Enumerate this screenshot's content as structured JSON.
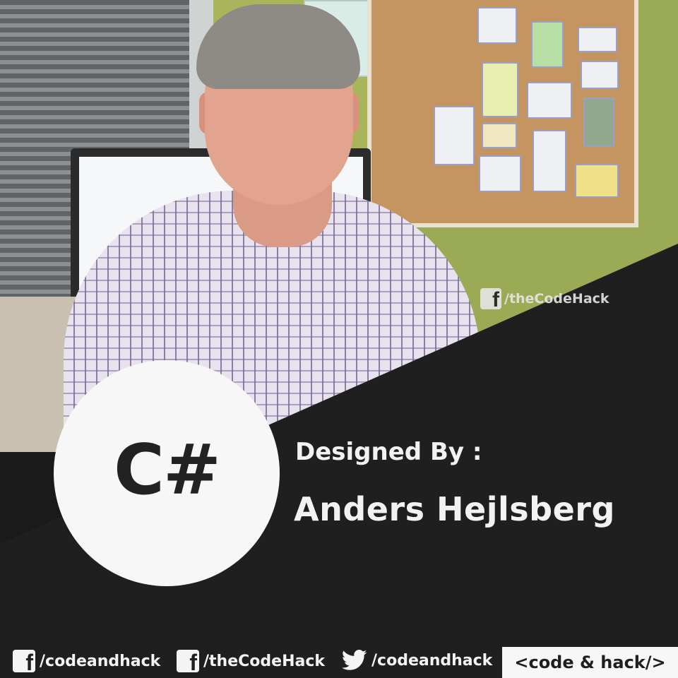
{
  "watermark": {
    "icon": "facebook-icon",
    "handle": "/theCodeHack"
  },
  "logo": {
    "text": "C#"
  },
  "caption": {
    "designed_by": "Designed By :",
    "name": "Anders Hejlsberg"
  },
  "footer": {
    "links": [
      {
        "icon": "facebook-icon",
        "handle": "/codeandhack"
      },
      {
        "icon": "facebook-icon",
        "handle": "/theCodeHack"
      },
      {
        "icon": "twitter-icon",
        "handle": "/codeandhack"
      }
    ],
    "brand": "<code & hack/>"
  },
  "colors": {
    "panel": "#1f1f1f",
    "text": "#f2f2f2",
    "circle": "#f7f7f7"
  }
}
